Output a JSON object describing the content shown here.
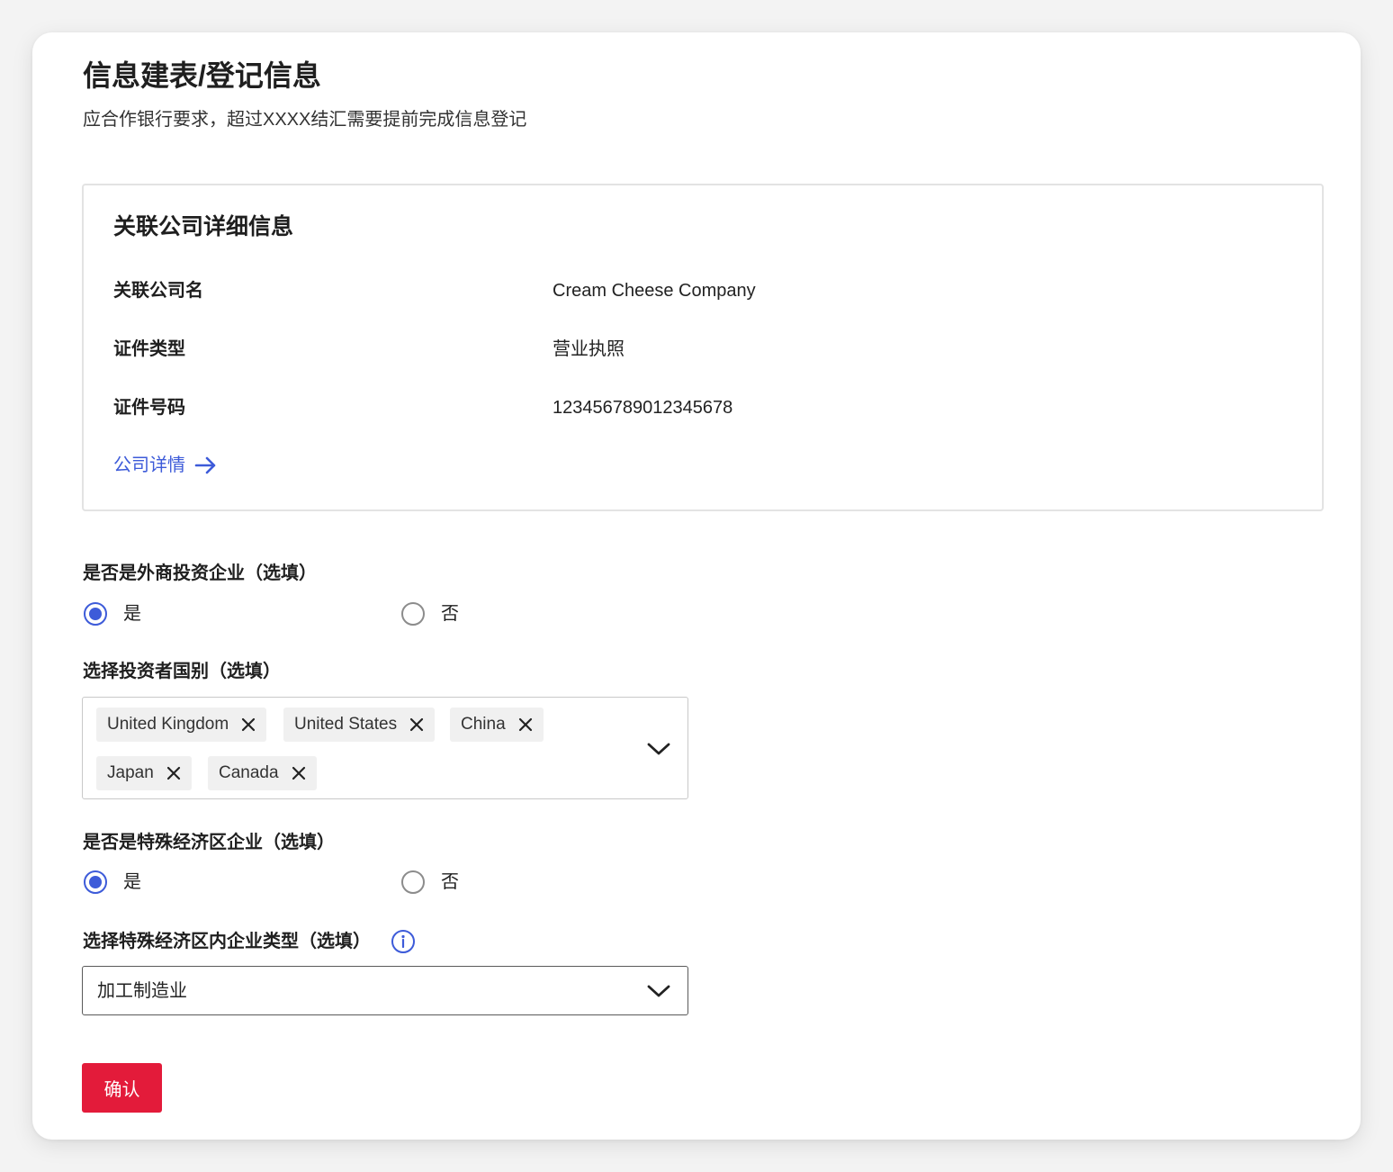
{
  "page": {
    "title": "信息建表/登记信息",
    "subtitle": "应合作银行要求，超过XXXX结汇需要提前完成信息登记"
  },
  "company_info": {
    "title": "关联公司详细信息",
    "rows": [
      {
        "label": "关联公司名",
        "value": "Cream Cheese Company"
      },
      {
        "label": "证件类型",
        "value": "营业执照"
      },
      {
        "label": "证件号码",
        "value": "123456789012345678"
      }
    ],
    "link_label": "公司详情"
  },
  "foreign_investment": {
    "label": "是否是外商投资企业（选填）",
    "options": [
      {
        "label": "是",
        "checked": true
      },
      {
        "label": "否",
        "checked": false
      }
    ]
  },
  "investor_countries": {
    "label": "选择投资者国别（选填）",
    "selected": [
      "United Kingdom",
      "United States",
      "China",
      "Japan",
      "Canada"
    ]
  },
  "special_economic_zone": {
    "label": "是否是特殊经济区企业（选填）",
    "options": [
      {
        "label": "是",
        "checked": true
      },
      {
        "label": "否",
        "checked": false
      }
    ]
  },
  "zone_enterprise_type": {
    "label": "选择特殊经济区内企业类型（选填）",
    "value": "加工制造业"
  },
  "actions": {
    "confirm_label": "确认"
  },
  "colors": {
    "accent_blue": "#3d5bd9",
    "primary_red": "#e31b3a"
  },
  "icons": {
    "link": "arrow-right-icon",
    "chip_remove": "close-icon",
    "dropdown": "chevron-down-icon",
    "help": "info-icon"
  }
}
